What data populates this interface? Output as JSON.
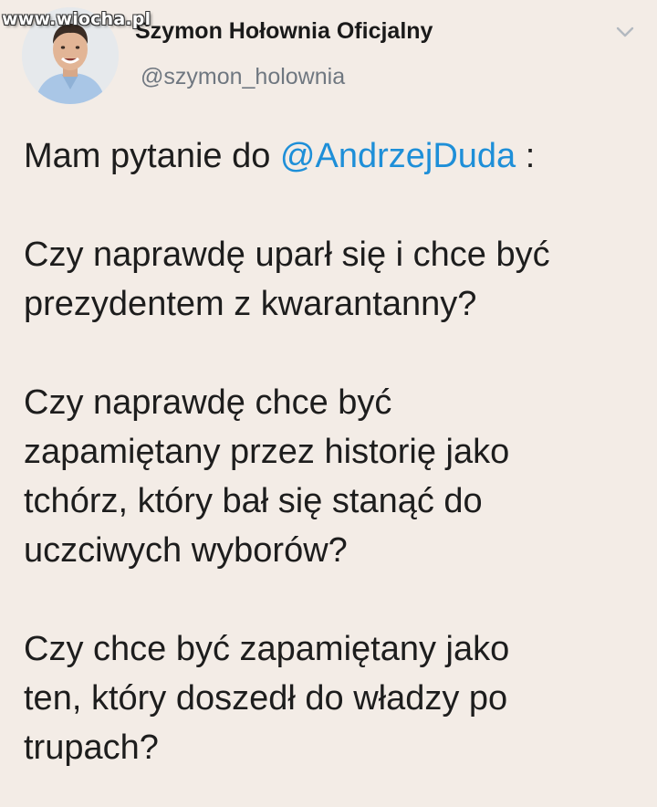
{
  "watermark": "www.wiocha.pl",
  "author": {
    "display_name": "Szymon Hołownia Oficjalny",
    "handle": "@szymon_holownia"
  },
  "header": {
    "menu_icon": "chevron-down-icon"
  },
  "tweet": {
    "intro_before": "Mam pytanie do ",
    "mention": "@AndrzejDuda",
    "intro_after": " :",
    "paragraph_2_line_1": "Czy naprawdę uparł się i chce być",
    "paragraph_2_line_2": "prezydentem z kwarantanny?",
    "paragraph_3_line_1": "Czy naprawdę chce być",
    "paragraph_3_line_2": "zapamiętany przez historię jako",
    "paragraph_3_line_3": "tchórz, który bał się stanąć do",
    "paragraph_3_line_4": "uczciwych wyborów?",
    "paragraph_4_line_1": "Czy chce być zapamiętany jako",
    "paragraph_4_line_2": "ten, który doszedł do władzy po",
    "paragraph_4_line_3": "trupach?"
  },
  "colors": {
    "background": "#f3ece6",
    "mention": "#1e8fd8",
    "handle": "#6f7780"
  }
}
